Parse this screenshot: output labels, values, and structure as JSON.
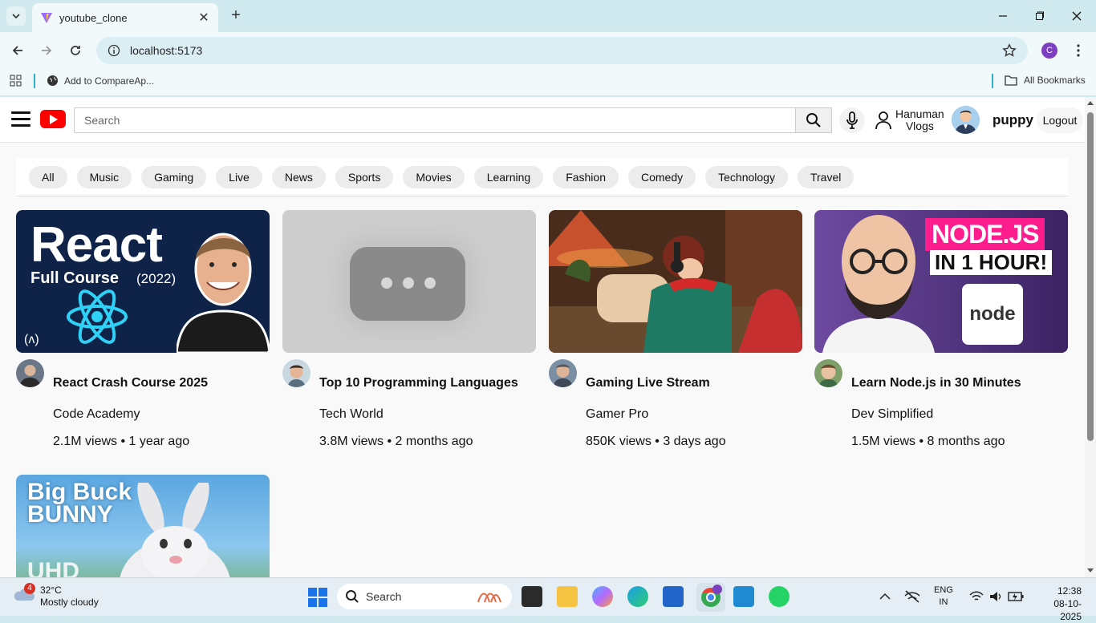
{
  "browser": {
    "tab_title": "youtube_clone",
    "url": "localhost:5173",
    "profile_initial": "C",
    "bookmark_1": "Add to CompareAp...",
    "all_bookmarks": "All Bookmarks"
  },
  "header": {
    "search_placeholder": "Search",
    "channel_line1": "Hanuman",
    "channel_line2": "Vlogs",
    "username": "puppy",
    "logout": "Logout"
  },
  "chips": [
    "All",
    "Music",
    "Gaming",
    "Live",
    "News",
    "Sports",
    "Movies",
    "Learning",
    "Fashion",
    "Comedy",
    "Technology",
    "Travel"
  ],
  "videos": [
    {
      "title": "React Crash Course 2025",
      "channel": "Code Academy",
      "meta": "2.1M views • 1 year ago",
      "thumb_text1": "React",
      "thumb_text2": "Full Course",
      "thumb_text3": "(2022)"
    },
    {
      "title": "Top 10 Programming Languages",
      "channel": "Tech World",
      "meta": "3.8M views • 2 months ago"
    },
    {
      "title": "Gaming Live Stream",
      "channel": "Gamer Pro",
      "meta": "850K views • 3 days ago"
    },
    {
      "title": "Learn Node.js in 30 Minutes",
      "channel": "Dev Simplified",
      "meta": "1.5M views • 8 months ago",
      "thumb_text1": "NODE.JS",
      "thumb_text2": "IN 1 HOUR!",
      "thumb_text3": "node"
    },
    {
      "thumb_text1": "Big Buck",
      "thumb_text2": "BUNNY",
      "thumb_text3": "UHD"
    }
  ],
  "taskbar": {
    "weather_temp": "32°C",
    "weather_desc": "Mostly cloudy",
    "weather_badge": "4",
    "search_label": "Search",
    "lang1": "ENG",
    "lang2": "IN",
    "time": "12:38",
    "date": "08-10-2025"
  }
}
